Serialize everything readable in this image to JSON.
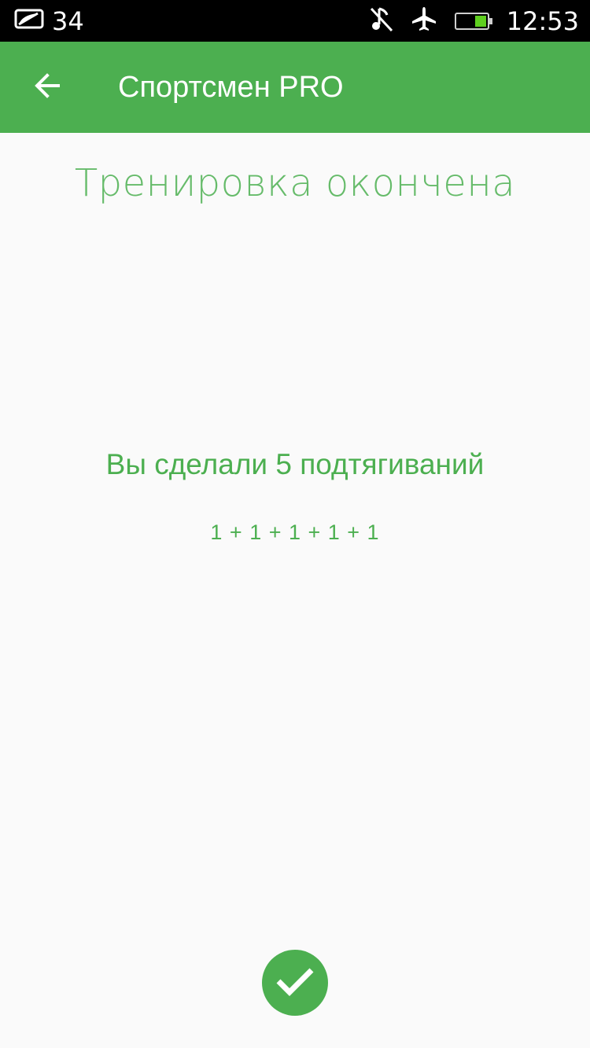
{
  "status_bar": {
    "notification_count": "34",
    "time": "12:53",
    "icons": [
      "message-icon",
      "music-off-icon",
      "airplane-mode-icon",
      "battery-icon"
    ]
  },
  "app_bar": {
    "title": "Спортсмен PRO",
    "back_icon": "arrow-back-icon"
  },
  "content": {
    "title": "Тренировка окончена",
    "summary": "Вы сделали 5 подтягиваний",
    "breakdown": "1 + 1 + 1 + 1 + 1"
  },
  "done_button": {
    "icon": "check-icon"
  },
  "colors": {
    "primary": "#4caf50",
    "title_text": "#66bb6a",
    "background": "#fafafa",
    "status_bar": "#000000"
  }
}
